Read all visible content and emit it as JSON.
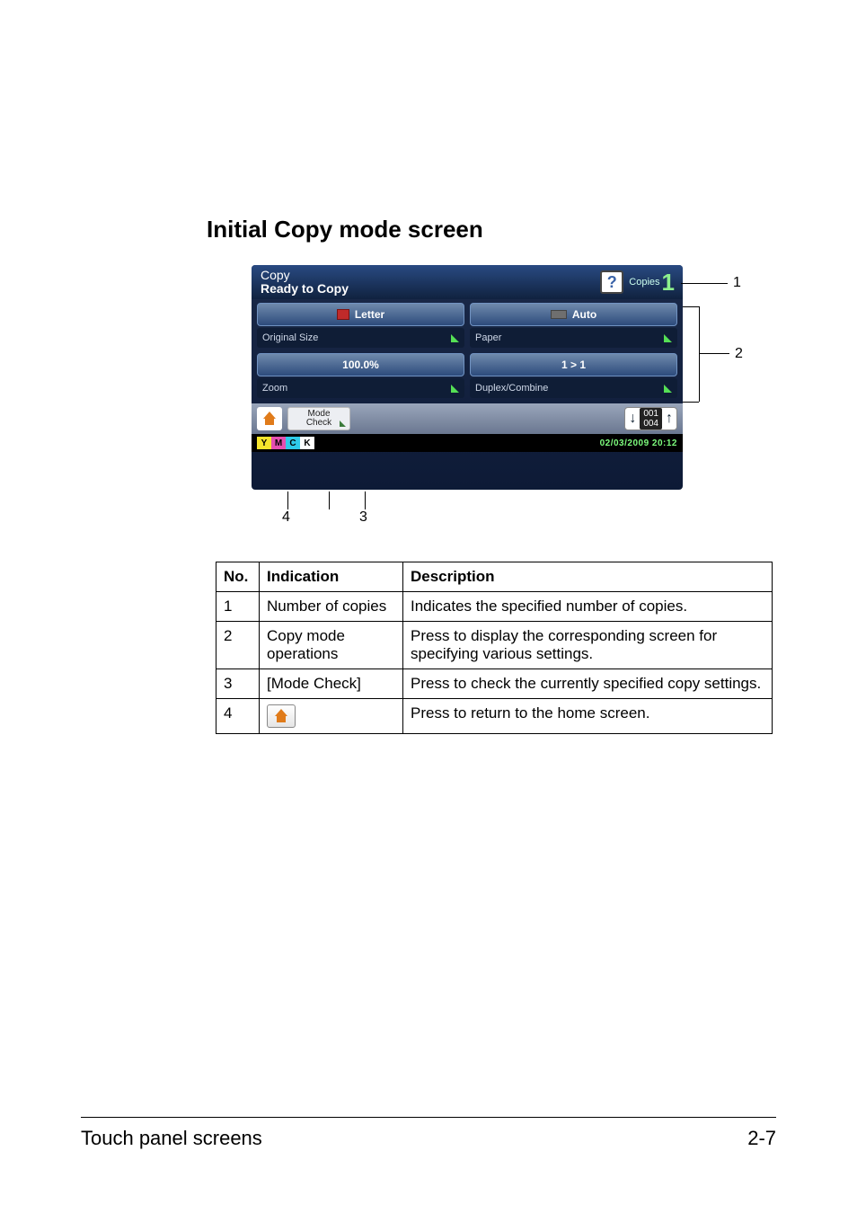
{
  "section_title": "Initial Copy mode screen",
  "callouts": {
    "c1": "1",
    "c2": "2",
    "c3": "3",
    "c4": "4"
  },
  "screen": {
    "header": {
      "mode": "Copy",
      "status": "Ready to Copy",
      "copies_label": "Copies",
      "copies_value": "1"
    },
    "buttons": {
      "orig_btn": "Letter",
      "orig_label": "Original Size",
      "paper_btn": "Auto",
      "paper_label": "Paper",
      "zoom_btn": "100.0%",
      "zoom_label": "Zoom",
      "duplex_btn": "1 > 1",
      "duplex_label": "Duplex/Combine"
    },
    "mode_check": {
      "l1": "Mode",
      "l2": "Check"
    },
    "page_indicator": {
      "current": "001",
      "total": "004"
    },
    "ymck": {
      "y": "Y",
      "m": "M",
      "c": "C",
      "k": "K"
    },
    "datetime": "02/03/2009 20:12"
  },
  "table": {
    "headers": {
      "no": "No.",
      "indication": "Indication",
      "description": "Description"
    },
    "rows": [
      {
        "no": "1",
        "indication": "Number of copies",
        "description": "Indicates the specified number of copies."
      },
      {
        "no": "2",
        "indication": "Copy mode operations",
        "description": "Press to display the corresponding screen for specifying various settings."
      },
      {
        "no": "3",
        "indication": "[Mode Check]",
        "description": "Press to check the currently specified copy settings."
      },
      {
        "no": "4",
        "indication": "",
        "description": "Press to return to the home screen."
      }
    ]
  },
  "footer": {
    "left": "Touch panel screens",
    "right": "2-7"
  }
}
